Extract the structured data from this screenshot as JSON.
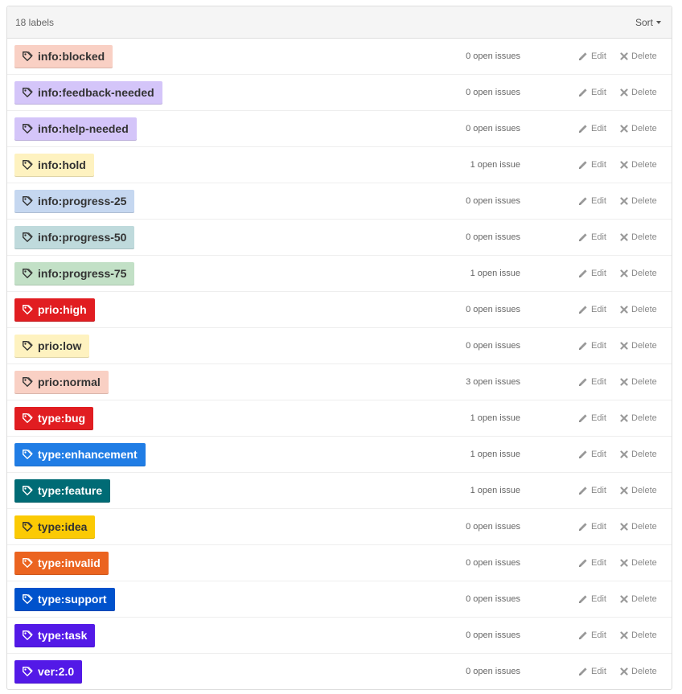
{
  "header": {
    "count": "18 labels",
    "sort_label": "Sort"
  },
  "actions": {
    "edit": "Edit",
    "delete": "Delete"
  },
  "labels": [
    {
      "name": "info:blocked",
      "issues": "0 open issues",
      "color": "#f9d0c4",
      "text_color": "#333333"
    },
    {
      "name": "info:feedback-needed",
      "issues": "0 open issues",
      "color": "#d4c5f9",
      "text_color": "#333333"
    },
    {
      "name": "info:help-needed",
      "issues": "0 open issues",
      "color": "#d4c5f9",
      "text_color": "#333333"
    },
    {
      "name": "info:hold",
      "issues": "1 open issue",
      "color": "#fef2c0",
      "text_color": "#333333"
    },
    {
      "name": "info:progress-25",
      "issues": "0 open issues",
      "color": "#c5d7f0",
      "text_color": "#333333"
    },
    {
      "name": "info:progress-50",
      "issues": "0 open issues",
      "color": "#bfdadc",
      "text_color": "#333333"
    },
    {
      "name": "info:progress-75",
      "issues": "1 open issue",
      "color": "#c2e0c6",
      "text_color": "#333333"
    },
    {
      "name": "prio:high",
      "issues": "0 open issues",
      "color": "#e11d21",
      "text_color": "#ffffff"
    },
    {
      "name": "prio:low",
      "issues": "0 open issues",
      "color": "#fef2c0",
      "text_color": "#333333"
    },
    {
      "name": "prio:normal",
      "issues": "3 open issues",
      "color": "#f9d0c4",
      "text_color": "#333333"
    },
    {
      "name": "type:bug",
      "issues": "1 open issue",
      "color": "#e11d21",
      "text_color": "#ffffff"
    },
    {
      "name": "type:enhancement",
      "issues": "1 open issue",
      "color": "#207de5",
      "text_color": "#ffffff"
    },
    {
      "name": "type:feature",
      "issues": "1 open issue",
      "color": "#006b75",
      "text_color": "#ffffff"
    },
    {
      "name": "type:idea",
      "issues": "0 open issues",
      "color": "#fbca04",
      "text_color": "#333333"
    },
    {
      "name": "type:invalid",
      "issues": "0 open issues",
      "color": "#eb6420",
      "text_color": "#ffffff"
    },
    {
      "name": "type:support",
      "issues": "0 open issues",
      "color": "#0052cc",
      "text_color": "#ffffff"
    },
    {
      "name": "type:task",
      "issues": "0 open issues",
      "color": "#5319e7",
      "text_color": "#ffffff"
    },
    {
      "name": "ver:2.0",
      "issues": "0 open issues",
      "color": "#5319e7",
      "text_color": "#ffffff"
    }
  ]
}
